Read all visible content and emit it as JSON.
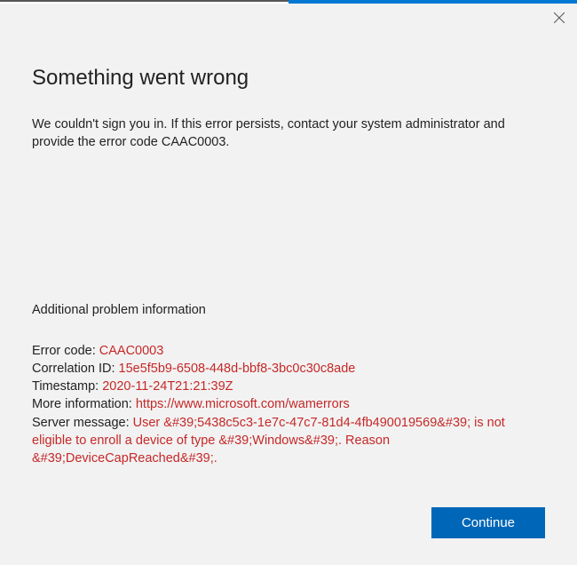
{
  "dialog": {
    "heading": "Something went wrong",
    "description": "We couldn't sign you in. If this error persists, contact your system administrator and provide the error code CAAC0003.",
    "subheading": "Additional problem information",
    "details": {
      "error_code_label": "Error code: ",
      "error_code_value": "CAAC0003",
      "correlation_label": "Correlation ID: ",
      "correlation_value": "15e5f5b9-6508-448d-bbf8-3bc0c30c8ade",
      "timestamp_label": "Timestamp: ",
      "timestamp_value": "2020-11-24T21:21:39Z",
      "moreinfo_label": "More information: ",
      "moreinfo_value": "https://www.microsoft.com/wamerrors",
      "servermsg_label": "Server message: ",
      "servermsg_value": "User &#39;5438c5c3-1e7c-47c7-81d4-4fb490019569&#39; is not eligible to enroll a device of type &#39;Windows&#39;. Reason &#39;DeviceCapReached&#39;."
    },
    "continue_label": "Continue"
  }
}
